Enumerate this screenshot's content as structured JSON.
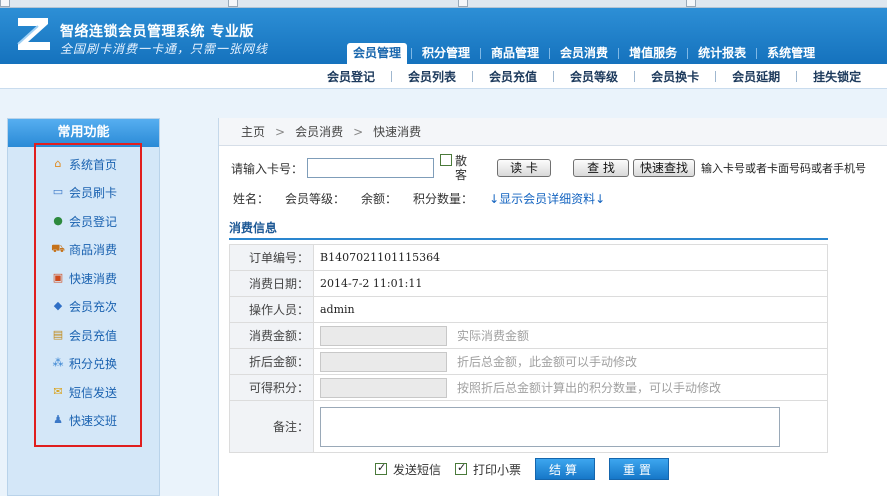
{
  "header": {
    "title": "智络连锁会员管理系统 专业版",
    "slogan": "全国刷卡消费一卡通，只需一张网线"
  },
  "main_nav": [
    {
      "label": "会员管理",
      "active": true
    },
    {
      "label": "积分管理"
    },
    {
      "label": "商品管理"
    },
    {
      "label": "会员消费"
    },
    {
      "label": "增值服务"
    },
    {
      "label": "统计报表"
    },
    {
      "label": "系统管理"
    }
  ],
  "sub_nav": [
    "会员登记",
    "会员列表",
    "会员充值",
    "会员等级",
    "会员换卡",
    "会员延期",
    "挂失锁定"
  ],
  "sidebar": {
    "title": "常用功能",
    "items": [
      {
        "label": "系统首页",
        "icon": "home-icon"
      },
      {
        "label": "会员刷卡",
        "icon": "card-swipe-icon"
      },
      {
        "label": "会员登记",
        "icon": "user-register-icon"
      },
      {
        "label": "商品消费",
        "icon": "cart-icon"
      },
      {
        "label": "快速消费",
        "icon": "quick-consume-icon"
      },
      {
        "label": "会员充次",
        "icon": "recharge-times-icon"
      },
      {
        "label": "会员充值",
        "icon": "recharge-icon"
      },
      {
        "label": "积分兑换",
        "icon": "points-exchange-icon"
      },
      {
        "label": "短信发送",
        "icon": "sms-icon"
      },
      {
        "label": "快速交班",
        "icon": "shift-icon"
      }
    ]
  },
  "breadcrumb": [
    "主页",
    "会员消费",
    "快速消费"
  ],
  "search": {
    "label": "请输入卡号：",
    "card_value": "",
    "scatter_label": "散客",
    "read_card_btn": "读 卡",
    "find_btn": "查 找",
    "quick_find_btn": "快速查找",
    "hint": "输入卡号或者卡面号码或者手机号"
  },
  "member_info": {
    "name_label": "姓名：",
    "level_label": "会员等级：",
    "balance_label": "余额：",
    "points_label": "积分数量：",
    "detail_link": "↓显示会员详细资料↓"
  },
  "section_title": "消费信息",
  "form": {
    "order_no_label": "订单编号：",
    "order_no": "B1407021101115364",
    "date_label": "消费日期：",
    "date": "2014-7-2 11:01:11",
    "operator_label": "操作人员：",
    "operator": "admin",
    "amount_label": "消费金额：",
    "amount_tip": "实际消费金额",
    "discount_label": "折后金额：",
    "discount_tip": "折后总金额，此金额可以手动修改",
    "points_label": "可得积分：",
    "points_tip": "按照折后总金额计算出的积分数量，可以手动修改",
    "memo_label": "备注："
  },
  "footer": {
    "sms_label": "发送短信",
    "print_label": "打印小票",
    "settle_btn": "结算",
    "reset_btn": "重置"
  },
  "colors": {
    "header_blue": "#1572bd",
    "highlight_red": "#e01e1e",
    "link_blue": "#1464c0"
  }
}
